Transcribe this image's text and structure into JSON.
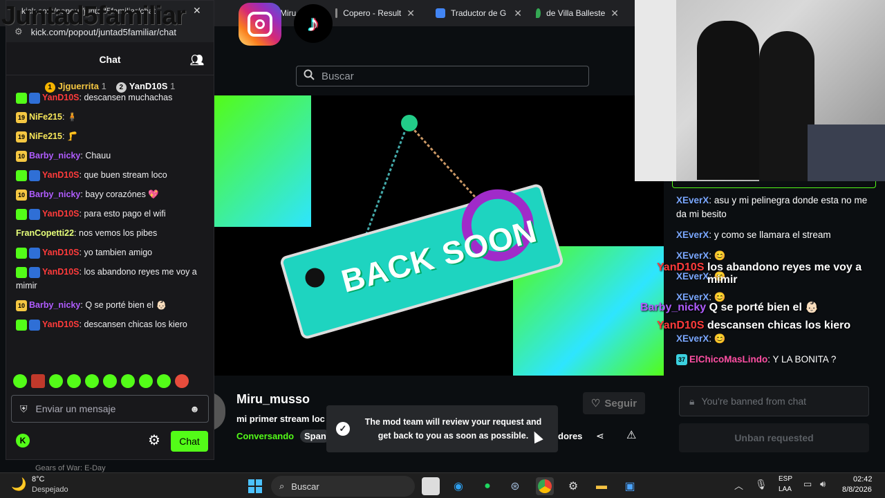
{
  "overlay": {
    "channel_text": "Juntad5familiar"
  },
  "browser": {
    "tabs": [
      {
        "label": "kick.com/popout/juntad5familiar/chat"
      },
      {
        "label": "Miru_musso St"
      },
      {
        "label": "Copero - Result"
      },
      {
        "label": "Traductor de G"
      },
      {
        "label": "de Villa Balleste"
      }
    ]
  },
  "popout": {
    "url": "kick.com/popout/juntad5familiar/chat",
    "title": "Chat",
    "pinned": [
      {
        "rank": "1",
        "name": "Jjguerrita",
        "count": "1"
      },
      {
        "rank": "2",
        "name": "YanD10S",
        "count": "1"
      }
    ],
    "messages": [
      {
        "badge": "mod",
        "user": "YanD10S",
        "color": "#ff3b3b",
        "text": "descansen muchachas"
      },
      {
        "badge": "19",
        "user": "NiFe215",
        "color": "#f7e65a",
        "text": "🧍"
      },
      {
        "badge": "19",
        "user": "NiFe215",
        "color": "#f7e65a",
        "text": "🦵"
      },
      {
        "badge": "10",
        "user": "Barby_nicky",
        "color": "#b05cff",
        "text": "Chauu"
      },
      {
        "badge": "mod",
        "user": "YanD10S",
        "color": "#ff3b3b",
        "text": "que buen stream loco"
      },
      {
        "badge": "10",
        "user": "Barby_nicky",
        "color": "#b05cff",
        "text": "bayy corazónes 💖"
      },
      {
        "badge": "mod",
        "user": "YanD10S",
        "color": "#ff3b3b",
        "text": "para esto pago el wifi"
      },
      {
        "badge": "",
        "user": "FranCopetti22",
        "color": "#e6ff7a",
        "text": "nos vemos los pibes"
      },
      {
        "badge": "mod",
        "user": "YanD10S",
        "color": "#ff3b3b",
        "text": "yo tambien amigo"
      },
      {
        "badge": "mod",
        "user": "YanD10S",
        "color": "#ff3b3b",
        "text": "los abandono reyes me voy a mimir"
      },
      {
        "badge": "10",
        "user": "Barby_nicky",
        "color": "#b05cff",
        "text": "Q se porté bien el 👶🏻"
      },
      {
        "badge": "mod",
        "user": "YanD10S",
        "color": "#ff3b3b",
        "text": "descansen chicas los kiero"
      }
    ],
    "input_placeholder": "Enviar un mensaje",
    "send_label": "Chat"
  },
  "page": {
    "search_placeholder": "Buscar",
    "offline_text": "BACK SOON",
    "streamer": "Miru_musso",
    "stream_title": "mi primer stream loc",
    "category": "Conversando",
    "tag": "Span",
    "follow_label": "Seguir",
    "viewers_fragment": "dores"
  },
  "toast": {
    "line1": "The mod team will review your request and",
    "line2": "get back to you as soon as possible."
  },
  "rchat": {
    "messages": [
      {
        "user": "XEverX",
        "text": "asu y mi pelinegra donde esta no me da mi besito"
      },
      {
        "user": "XEverX",
        "text": "y como se llamara el stream"
      },
      {
        "user": "XEverX",
        "text": "😊"
      },
      {
        "user": "XEverX",
        "text": "😊"
      },
      {
        "user": "XEverX",
        "text": "😊"
      },
      {
        "user": "XEverX",
        "text": "😊"
      }
    ],
    "overlay_lines": [
      {
        "user": "YanD10S",
        "text": "los abandono reyes me voy a mimir"
      },
      {
        "user": "Barby_nicky",
        "text": "Q se porté bien el 👶🏻"
      },
      {
        "user": "YanD10S",
        "text": "descansen chicas los kiero"
      }
    ],
    "last": {
      "badge": "37",
      "user": "ElChicoMasLindo",
      "text": "Y LA BONITA ?"
    },
    "banned_text": "You're banned from chat",
    "unban_label": "Unban requested"
  },
  "taskbar": {
    "weather_temp": "8°C",
    "weather_desc": "Despejado",
    "search_label": "Buscar",
    "lang": "ESP",
    "lang2": "LAA",
    "time": "02:42",
    "date": "8/8/2026",
    "behind_text": "Gears of War: E-Day"
  }
}
